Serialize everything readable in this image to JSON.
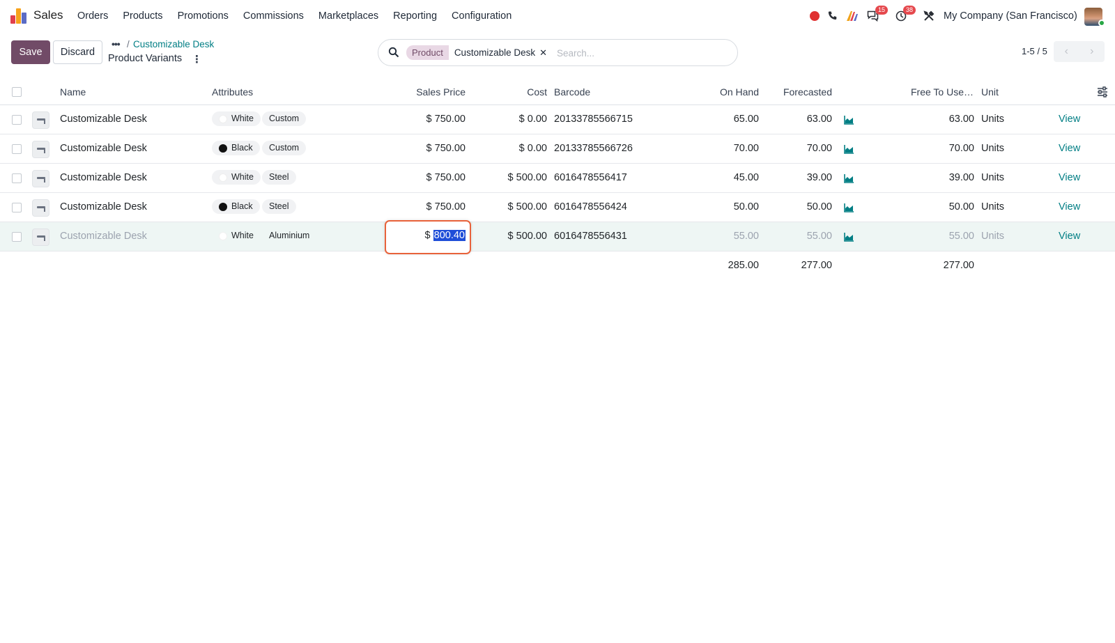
{
  "app": {
    "name": "Sales",
    "logo_colors": [
      "#e13f4c",
      "#f7a21a",
      "#5b6cc6"
    ]
  },
  "menu": [
    "Orders",
    "Products",
    "Promotions",
    "Commissions",
    "Marketplaces",
    "Reporting",
    "Configuration"
  ],
  "systray": {
    "messages_count": "15",
    "activities_count": "38",
    "company": "My Company (San Francisco)"
  },
  "control": {
    "save_label": "Save",
    "discard_label": "Discard",
    "breadcrumb_parent": "Customizable Desk",
    "breadcrumb_current": "Product Variants"
  },
  "search": {
    "facet_label": "Product",
    "facet_value": "Customizable Desk",
    "placeholder": "Search..."
  },
  "pager": {
    "text": "1-5 / 5"
  },
  "columns": {
    "name": "Name",
    "attributes": "Attributes",
    "sales_price": "Sales Price",
    "cost": "Cost",
    "barcode": "Barcode",
    "on_hand": "On Hand",
    "forecasted": "Forecasted",
    "free_to_use": "Free To Use…",
    "unit": "Unit"
  },
  "rows": [
    {
      "name": "Customizable Desk",
      "color": "White",
      "color_hex": "#ffffff",
      "material": "Custom",
      "price": "$ 750.00",
      "cost": "$ 0.00",
      "barcode": "20133785566715",
      "on_hand": "65.00",
      "forecasted": "63.00",
      "free": "63.00",
      "unit": "Units",
      "view": "View"
    },
    {
      "name": "Customizable Desk",
      "color": "Black",
      "color_hex": "#111111",
      "material": "Custom",
      "price": "$ 750.00",
      "cost": "$ 0.00",
      "barcode": "20133785566726",
      "on_hand": "70.00",
      "forecasted": "70.00",
      "free": "70.00",
      "unit": "Units",
      "view": "View"
    },
    {
      "name": "Customizable Desk",
      "color": "White",
      "color_hex": "#ffffff",
      "material": "Steel",
      "price": "$ 750.00",
      "cost": "$ 500.00",
      "barcode": "6016478556417",
      "on_hand": "45.00",
      "forecasted": "39.00",
      "free": "39.00",
      "unit": "Units",
      "view": "View"
    },
    {
      "name": "Customizable Desk",
      "color": "Black",
      "color_hex": "#111111",
      "material": "Steel",
      "price": "$ 750.00",
      "cost": "$ 500.00",
      "barcode": "6016478556424",
      "on_hand": "50.00",
      "forecasted": "50.00",
      "free": "50.00",
      "unit": "Units",
      "view": "View"
    },
    {
      "name": "Customizable Desk",
      "color": "White",
      "color_hex": "#ffffff",
      "material": "Aluminium",
      "price_currency": "$",
      "price_value": "800.40",
      "cost": "$ 500.00",
      "barcode": "6016478556431",
      "on_hand": "55.00",
      "forecasted": "55.00",
      "free": "55.00",
      "unit": "Units",
      "view": "View"
    }
  ],
  "totals": {
    "on_hand": "285.00",
    "forecasted": "277.00",
    "free": "277.00"
  },
  "accent": "#714b67",
  "link_color": "#017e84"
}
